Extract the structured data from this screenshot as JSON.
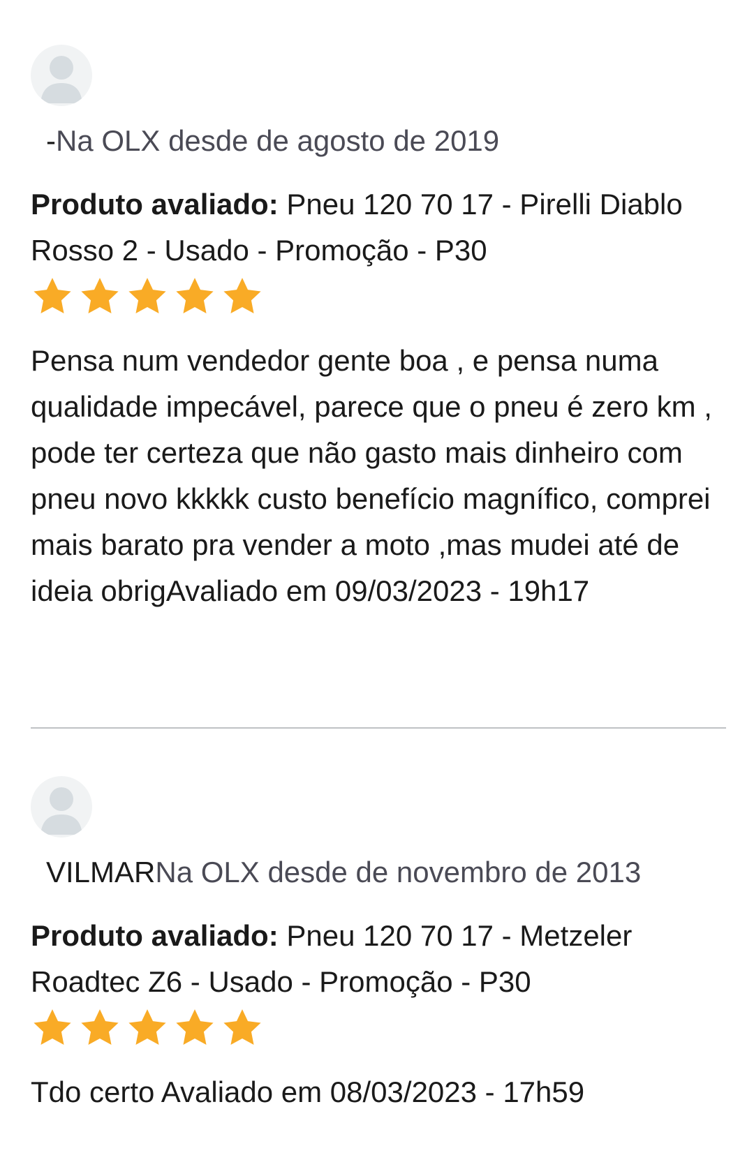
{
  "reviews": [
    {
      "seller_name": "-",
      "member_since": "Na OLX desde de agosto de 2019",
      "product_label": "Produto avaliado:",
      "product_name": "Pneu 120 70 17 - Pirelli Diablo Rosso 2 - Usado - Promoção - P30",
      "rating": 5,
      "rating_max": 5,
      "comment": "Pensa num vendedor gente boa , e pensa numa qualidade impecável, parece que o pneu é zero km , pode ter certeza que não gasto mais dinheiro com pneu novo kkkkk custo benefício magnífico, comprei mais barato pra vender a moto ,mas mudei até de ideia obrig",
      "reviewed_at": "Avaliado em 09/03/2023 - 19h17"
    },
    {
      "seller_name": "VILMAR",
      "member_since": "Na OLX desde de novembro de 2013",
      "product_label": "Produto avaliado:",
      "product_name": "Pneu 120 70 17 - Metzeler Roadtec Z6 - Usado - Promoção - P30",
      "rating": 5,
      "rating_max": 5,
      "comment": "Tdo certo ",
      "reviewed_at": "Avaliado em 08/03/2023 - 17h59"
    }
  ],
  "colors": {
    "star": "#f9ab26",
    "avatar_bg": "#f1f3f4",
    "avatar_figure": "#d6dce0",
    "divider": "#bfc1c4",
    "muted_text": "#4a4a55"
  },
  "icons": {
    "avatar": "user-silhouette-icon",
    "star": "star-filled-icon"
  }
}
